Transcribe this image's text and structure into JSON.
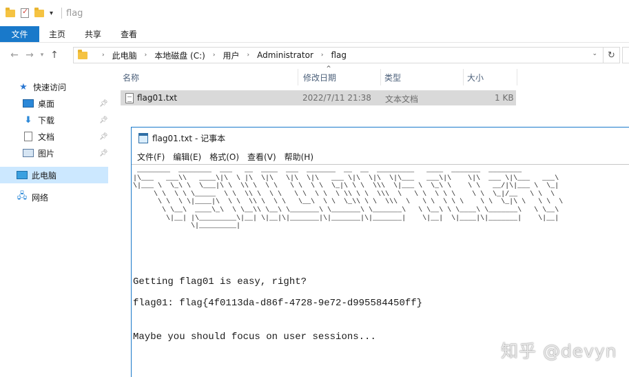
{
  "window": {
    "title": "flag"
  },
  "ribbon": {
    "tabs": [
      "文件",
      "主页",
      "共享",
      "查看"
    ]
  },
  "address": {
    "crumbs": [
      "此电脑",
      "本地磁盘 (C:)",
      "用户",
      "Administrator",
      "flag"
    ]
  },
  "nav": {
    "quick_access": "快速访问",
    "items": [
      "桌面",
      "下载",
      "文档",
      "图片"
    ],
    "this_pc": "此电脑",
    "network": "网络"
  },
  "columns": [
    "名称",
    "修改日期",
    "类型",
    "大小"
  ],
  "files": [
    {
      "name": "flag01.txt",
      "modified": "2022/7/11 21:38",
      "type": "文本文档",
      "size": "1 KB"
    }
  ],
  "notepad": {
    "title": "flag01.txt - 记事本",
    "menu": [
      "文件(F)",
      "编辑(E)",
      "格式(O)",
      "查看(V)",
      "帮助(H)"
    ],
    "ascii_art": " ________  ________  ___   __  ____  ___  _______  __  __  _________   ____  _______  ________\n|\\___   ___\\\\   ____\\|\\  \\ |\\  \\|\\   \\|\\  \\|\\   ___ \\|\\  \\|\\  \\|\\___   ___\\|\\    \\|\\  ___ \\|\\___   ___\\\n\\|___ \\  \\_\\ \\  \\___|\\ \\  \\\\ \\  \\ \\   \\ \\  \\ \\  \\_|\\ \\ \\  \\\\\\  \\|___ \\  \\_\\ \\    \\ \\   __/|\\|___ \\  \\_|\n     \\ \\  \\ \\ \\_____  \\ \\  \\\\ \\  \\ \\   \\ \\  \\ \\  \\ \\\\ \\ \\  \\\\\\  \\   \\ \\  \\ \\ \\    \\ \\  \\_|/__   \\ \\  \\\n      \\ \\  \\ \\|____|\\  \\ \\  \\\\ \\  \\ \\   \\__\\  \\ \\  \\_\\\\ \\ \\  \\\\\\  \\   \\ \\  \\ \\ \\    \\ \\  \\_|\\ \\   \\ \\  \\\n       \\ \\__\\  ____\\_\\  \\ \\__\\\\ \\__\\ \\_______\\ \\_______\\ \\_______\\   \\ \\__\\ \\ \\____\\ \\_______\\   \\ \\__\\\n        \\|__| |\\_________\\|__| \\|__|\\|_______|\\|_______|\\|_______|    \\|__|  \\|____|\\|_______|    \\|__|\n              \\|_________|",
    "lines": [
      "Getting flag01 is easy, right?",
      "flag01: flag{4f0113da-d86f-4728-9e72-d995584450ff}",
      "Maybe you should focus on user sessions..."
    ]
  },
  "watermark": "知乎 @devyn"
}
